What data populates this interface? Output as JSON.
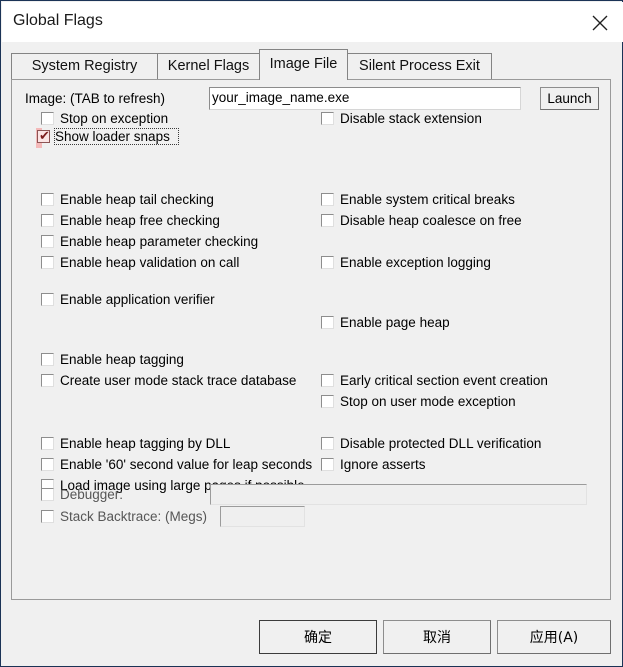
{
  "window": {
    "title": "Global Flags",
    "close_icon": "close-icon"
  },
  "tabs": [
    {
      "label": "System Registry",
      "selected": false
    },
    {
      "label": "Kernel Flags",
      "selected": false
    },
    {
      "label": "Image File",
      "selected": true
    },
    {
      "label": "Silent Process Exit",
      "selected": false
    }
  ],
  "image_row": {
    "label": "Image: (TAB to refresh)",
    "value": "your_image_name.exe",
    "placeholder": "",
    "launch_label": "Launch"
  },
  "left_column": [
    {
      "label": "Stop on exception",
      "checked": false,
      "disabled": false,
      "highlight": false
    },
    {
      "label": "Show loader snaps",
      "checked": true,
      "disabled": false,
      "highlight": true
    },
    {
      "label": "Enable heap tail checking",
      "checked": false,
      "disabled": false,
      "highlight": false
    },
    {
      "label": "Enable heap free checking",
      "checked": false,
      "disabled": false,
      "highlight": false
    },
    {
      "label": "Enable heap parameter checking",
      "checked": false,
      "disabled": false,
      "highlight": false
    },
    {
      "label": "Enable heap validation on call",
      "checked": false,
      "disabled": false,
      "highlight": false
    },
    {
      "label": "Enable application verifier",
      "checked": false,
      "disabled": false,
      "highlight": false
    },
    {
      "label": "Enable heap tagging",
      "checked": false,
      "disabled": false,
      "highlight": false
    },
    {
      "label": "Create user mode stack trace database",
      "checked": false,
      "disabled": false,
      "highlight": false
    },
    {
      "label": "Enable heap tagging by DLL",
      "checked": false,
      "disabled": false,
      "highlight": false
    },
    {
      "label": "Enable '60' second value for leap seconds",
      "checked": false,
      "disabled": false,
      "highlight": false
    },
    {
      "label": "Load image using large pages if possible",
      "checked": false,
      "disabled": false,
      "highlight": false
    }
  ],
  "right_column": [
    {
      "label": "Disable stack extension",
      "checked": false
    },
    {
      "label": "Enable system critical breaks",
      "checked": false
    },
    {
      "label": "Disable heap coalesce on free",
      "checked": false
    },
    {
      "label": "Enable exception logging",
      "checked": false
    },
    {
      "label": "Enable page heap",
      "checked": false
    },
    {
      "label": "Early critical section event creation",
      "checked": false
    },
    {
      "label": "Stop on user mode exception",
      "checked": false
    },
    {
      "label": "Disable protected DLL verification",
      "checked": false
    },
    {
      "label": "Ignore asserts",
      "checked": false
    }
  ],
  "debugger_row": {
    "label": "Debugger:",
    "checked": false,
    "value": "",
    "disabled": true
  },
  "stack_backtrace_row": {
    "label": "Stack Backtrace: (Megs)",
    "checked": false,
    "value": "",
    "disabled": true
  },
  "footer": {
    "ok_label": "确定",
    "cancel_label": "取消",
    "apply_label": "应用(A)"
  },
  "colors": {
    "dialog_bg": "#f0f0f0",
    "titlebar_bg": "#ffffff",
    "window_border": "#1b3356",
    "highlight_bg": "#f4b9b9",
    "check_color": "#7c1d1d",
    "field_bg": "#ffffff",
    "disabled_text": "#787878"
  }
}
